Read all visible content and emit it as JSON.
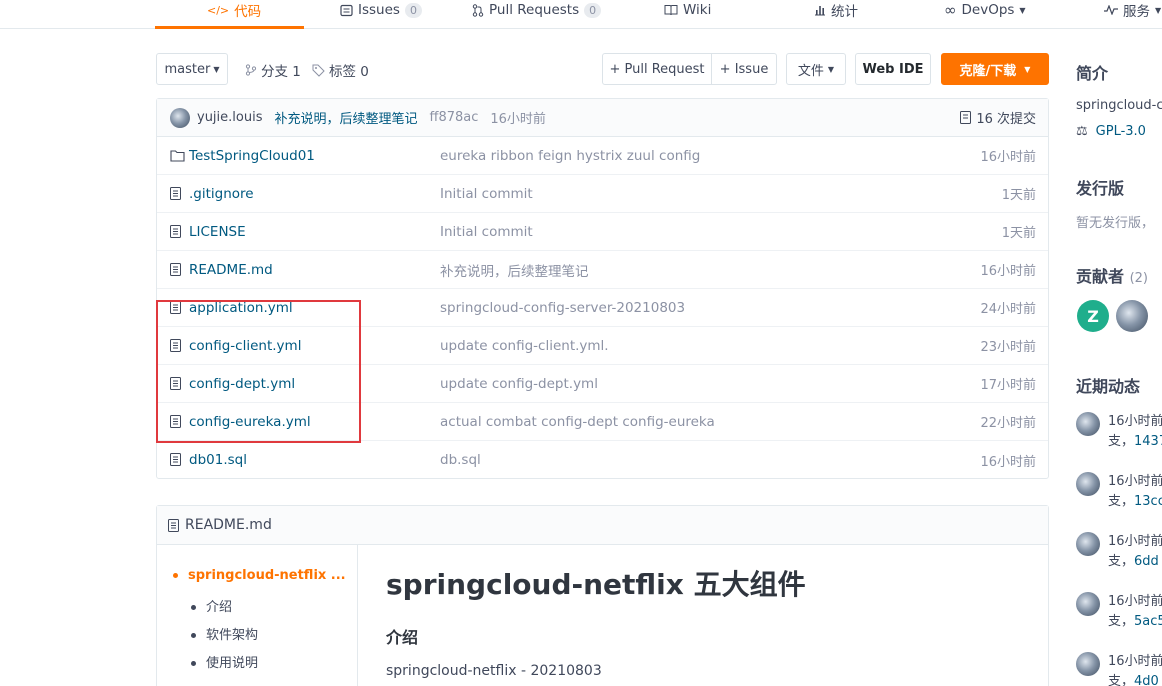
{
  "nav": {
    "items": [
      {
        "label": "代码",
        "icon": "code-icon",
        "active": true
      },
      {
        "label": "Issues",
        "icon": "issues-icon",
        "count": "0"
      },
      {
        "label": "Pull Requests",
        "icon": "pull-request-icon",
        "count": "0"
      },
      {
        "label": "Wiki",
        "icon": "wiki-icon"
      },
      {
        "label": "统计",
        "icon": "stats-icon"
      },
      {
        "label": "DevOps",
        "icon": "devops-icon"
      },
      {
        "label": "服务",
        "icon": "service-icon"
      }
    ],
    "accent": "#fe7300"
  },
  "toolbar": {
    "branch": "master",
    "branches": "分支 1",
    "tags": "标签 0",
    "pull_request": "+ Pull Request",
    "issue": "+ Issue",
    "file": "文件",
    "web_ide": "Web IDE",
    "clone": "克隆/下载"
  },
  "commit": {
    "author": "yujie.louis",
    "message": "补充说明，后续整理笔记",
    "hash": "ff878ac",
    "time": "16小时前",
    "count": "16 次提交"
  },
  "files": [
    {
      "name": "TestSpringCloud01",
      "type": "folder",
      "message": "eureka ribbon feign hystrix zuul config",
      "time": "16小时前"
    },
    {
      "name": ".gitignore",
      "type": "file",
      "message": "Initial commit",
      "time": "1天前"
    },
    {
      "name": "LICENSE",
      "type": "file",
      "message": "Initial commit",
      "time": "1天前"
    },
    {
      "name": "README.md",
      "type": "file",
      "message": "补充说明，后续整理笔记",
      "time": "16小时前"
    },
    {
      "name": "application.yml",
      "type": "file",
      "message": "springcloud-config-server-20210803",
      "time": "24小时前"
    },
    {
      "name": "config-client.yml",
      "type": "file",
      "message": "update config-client.yml.",
      "time": "23小时前"
    },
    {
      "name": "config-dept.yml",
      "type": "file",
      "message": "update config-dept.yml",
      "time": "17小时前"
    },
    {
      "name": "config-eureka.yml",
      "type": "file",
      "message": "actual combat config-dept config-eureka",
      "time": "22小时前"
    },
    {
      "name": "db01.sql",
      "type": "file",
      "message": "db.sql",
      "time": "16小时前"
    }
  ],
  "readme": {
    "filename": "README.md",
    "toc": [
      {
        "label": "springcloud-netflix ...",
        "active": true
      },
      {
        "label": "介绍"
      },
      {
        "label": "软件架构"
      },
      {
        "label": "使用说明"
      }
    ],
    "title": "springcloud-netflix 五大组件",
    "h2": "介绍",
    "para": "springcloud-netflix - 20210803"
  },
  "sidebar": {
    "intro_h": "简介",
    "intro_text": "springcloud-c",
    "license": "GPL-3.0",
    "release_h": "发行版",
    "release_text": "暂无发行版，",
    "contrib_h": "贡献者",
    "contrib_count": "(2)",
    "contrib_letter": "Z",
    "activity_h": "近期动态",
    "activity": [
      {
        "time": "16小时前",
        "prefix": "支，",
        "hash": "1437"
      },
      {
        "time": "16小时前",
        "prefix": "支，",
        "hash": "13cc"
      },
      {
        "time": "16小时前",
        "prefix": "支，",
        "hash": "6dd"
      },
      {
        "time": "16小时前",
        "prefix": "支，",
        "hash": "5ac5"
      },
      {
        "time": "16小时前",
        "prefix": "支，",
        "hash": "4d0"
      }
    ]
  }
}
